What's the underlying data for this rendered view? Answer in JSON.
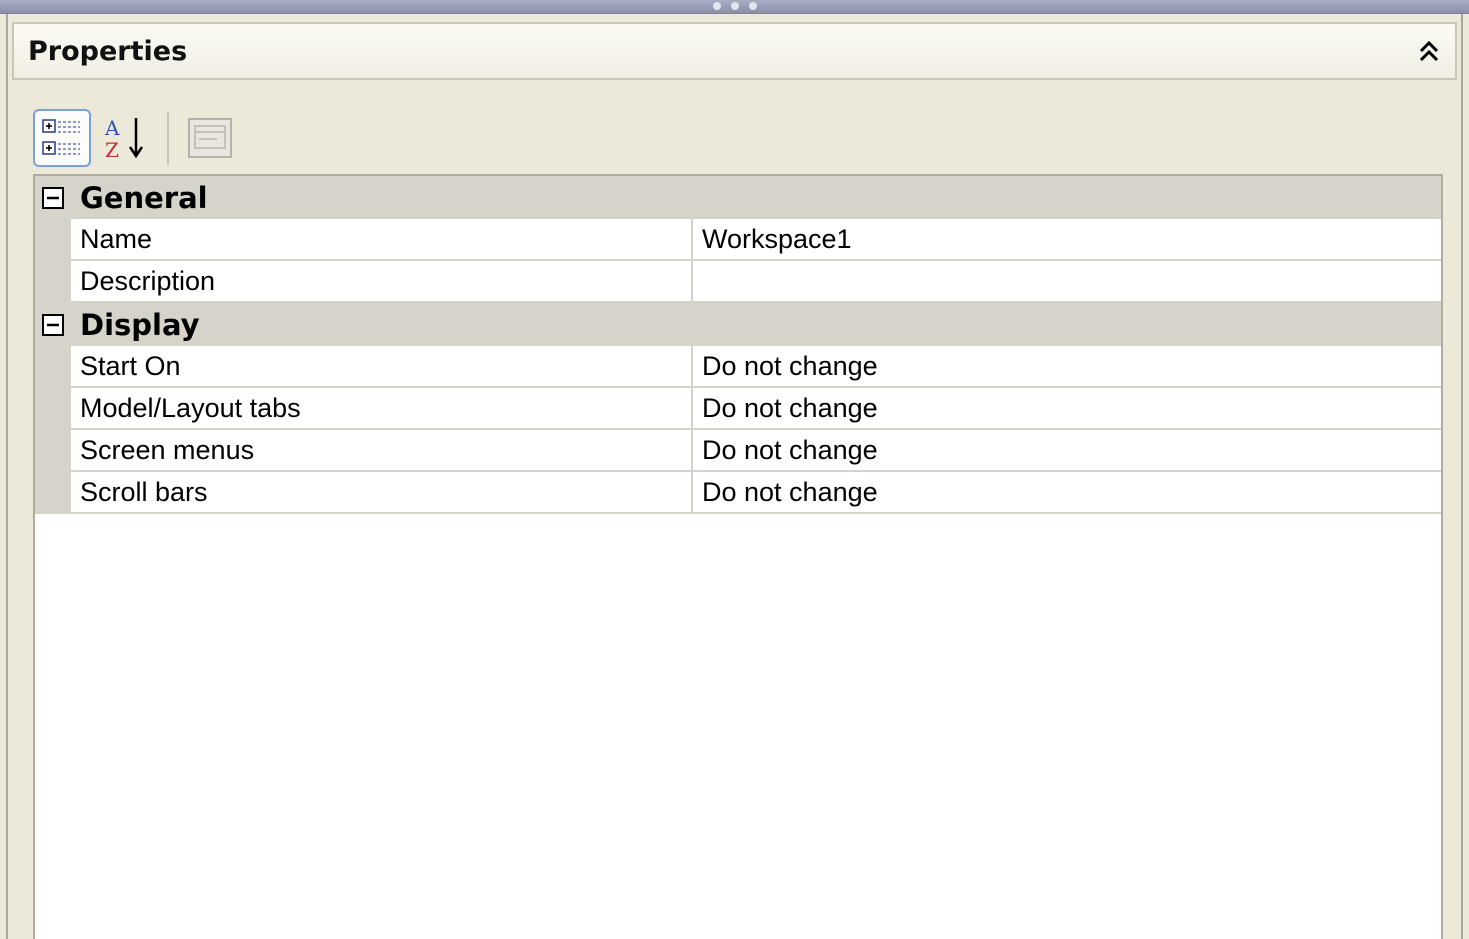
{
  "panel": {
    "title": "Properties"
  },
  "toolbar": {
    "categorized_icon": "categorized-view-icon",
    "alphabetical_icon": "alphabetical-sort-icon",
    "property_pages_icon": "property-pages-icon"
  },
  "categories": [
    {
      "label": "General",
      "expanded": true,
      "properties": [
        {
          "name": "Name",
          "value": "Workspace1"
        },
        {
          "name": "Description",
          "value": ""
        }
      ]
    },
    {
      "label": "Display",
      "expanded": true,
      "properties": [
        {
          "name": "Start On",
          "value": "Do not change"
        },
        {
          "name": "Model/Layout tabs",
          "value": "Do not change"
        },
        {
          "name": "Screen menus",
          "value": "Do not change"
        },
        {
          "name": "Scroll bars",
          "value": "Do not change"
        }
      ]
    }
  ],
  "colors": {
    "panel_bg": "#ece9d8",
    "category_bg": "#d6d3ca",
    "grid_bg": "#ffffff",
    "accent_border": "#7aa0d8"
  }
}
